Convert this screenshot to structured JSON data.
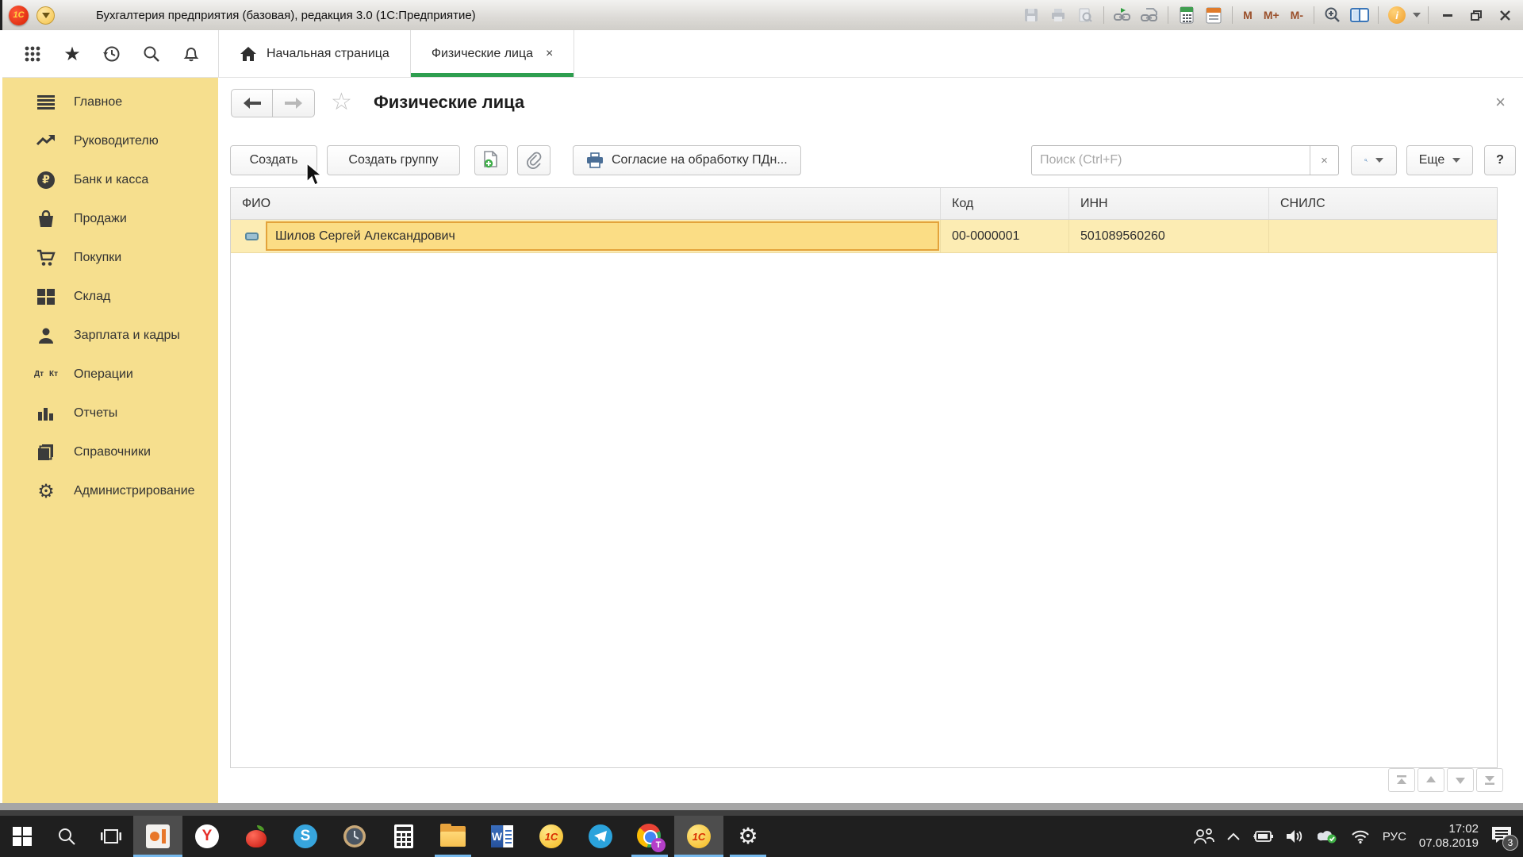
{
  "titlebar": {
    "app_title": "Бухгалтерия предприятия (базовая), редакция 3.0  (1С:Предприятие)",
    "logo": "1С",
    "memory": [
      "M",
      "M+",
      "M-"
    ],
    "info_glyph": "i"
  },
  "tabbar": {
    "home_tab": "Начальная страница",
    "active_tab": "Физические лица",
    "active_tab_close": "×"
  },
  "sidebar": {
    "ruble_glyph": "₽",
    "items": [
      {
        "label": "Главное"
      },
      {
        "label": "Руководителю"
      },
      {
        "label": "Банк и касса"
      },
      {
        "label": "Продажи"
      },
      {
        "label": "Покупки"
      },
      {
        "label": "Склад"
      },
      {
        "label": "Зарплата и кадры"
      },
      {
        "label": "Операции",
        "icon_top": "Дт",
        "icon_bottom": "Кт"
      },
      {
        "label": "Отчеты"
      },
      {
        "label": "Справочники"
      },
      {
        "label": "Администрирование"
      }
    ]
  },
  "form": {
    "title": "Физические лица",
    "close": "×",
    "toolbar": {
      "create": "Создать",
      "create_group": "Создать группу",
      "consent": "Согласие на обработку ПДн...",
      "search_placeholder": "Поиск (Ctrl+F)",
      "search_clear": "×",
      "more": "Еще",
      "help": "?"
    },
    "table": {
      "columns": [
        "ФИО",
        "Код",
        "ИНН",
        "СНИЛС"
      ],
      "rows": [
        {
          "fio": "Шилов Сергей Александрович",
          "code": "00-0000001",
          "inn": "501089560260",
          "snils": ""
        }
      ]
    }
  },
  "taskbar": {
    "yandex_glyph": "Y",
    "skype_glyph": "S",
    "word_glyph": "W",
    "onec_glyph": "1С",
    "telegram_badge_glyph": "Т",
    "language": "РУС",
    "time": "17:02",
    "date": "07.08.2019",
    "notification_count": "3"
  },
  "colors": {
    "sidebar_bg": "#f6df8e",
    "selected_row_bg": "#fcecb3",
    "selected_cell_bg": "#fbdd85",
    "selected_cell_border": "#e3a33b",
    "active_tab_underline": "#2e9e4f",
    "taskbar_bg": "#1f1f1f",
    "run_indicator": "#76b9ed"
  }
}
